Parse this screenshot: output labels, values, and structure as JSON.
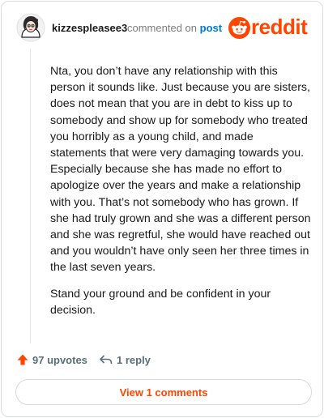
{
  "header": {
    "username": "kizzespleasee3",
    "commented_on": "commented on",
    "post_link": "post",
    "logo_text": "reddit",
    "avatar_icon": "cartoon-avatar-icon",
    "logo_icon": "reddit-snoo-icon"
  },
  "comment": {
    "paragraphs": [
      "Nta, you don’t have any relationship with this person it sounds like. Just because you are sisters, does not mean that you are in debt to kiss up to somebody and show up for somebody who treated you horribly as a young child, and made statements that were very damaging towards you. Especially because she has made no effort to apologize over the years and make a relationship with you. That’s not somebody who has grown. If she had truly grown and she was a different person and she was regretful, she would have reached out and you wouldn’t have only seen her three times in the last seven years.",
      "Stand your ground and be confident in your decision."
    ]
  },
  "actions": {
    "upvotes": "97 upvotes",
    "replies": "1 reply",
    "upvote_icon": "upvote-arrow-icon",
    "reply_icon": "reply-arrow-icon"
  },
  "footer": {
    "view_comments": "View 1 comments"
  },
  "colors": {
    "accent": "#ff4500",
    "link": "#0079d3",
    "muted": "#576f76",
    "border": "#d9dcde"
  }
}
